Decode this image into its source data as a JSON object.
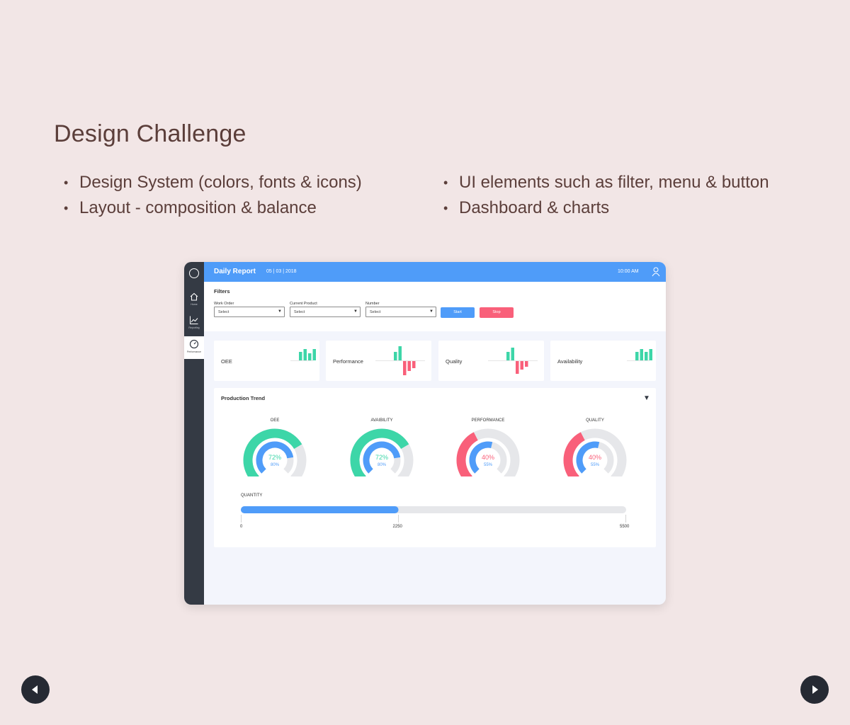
{
  "slide": {
    "title": "Design Challenge",
    "bullets_left": [
      "Design System (colors, fonts & icons)",
      "Layout - composition & balance"
    ],
    "bullets_right": [
      "UI elements such as filter, menu & button",
      "Dashboard & charts"
    ]
  },
  "nav": {
    "prev_icon": "arrow-left-icon",
    "next_icon": "arrow-right-icon"
  },
  "app": {
    "header": {
      "title": "Daily Report",
      "date": "05 | 03 | 2018",
      "time": "10:00 AM",
      "user_icon": "user-icon"
    },
    "sidebar": {
      "items": [
        {
          "label": "Home",
          "icon": "home-icon"
        },
        {
          "label": "Reporting",
          "icon": "chart-line-icon"
        },
        {
          "label": "Performance",
          "icon": "speedometer-icon",
          "active": true
        }
      ]
    },
    "filters": {
      "title": "Filters",
      "fields": [
        {
          "label": "Work Order",
          "value": "Select"
        },
        {
          "label": "Current Product",
          "value": "Select"
        },
        {
          "label": "Number",
          "value": "Select"
        }
      ],
      "start_label": "Start",
      "stop_label": "Stop"
    },
    "kpis": [
      {
        "label": "OEE",
        "bars": [
          3,
          4,
          2.5,
          4
        ],
        "neg_bars": []
      },
      {
        "label": "Performance",
        "bars": [
          3,
          5
        ],
        "neg_bars": [
          5,
          3.5,
          2.5
        ]
      },
      {
        "label": "Quality",
        "bars": [
          3,
          4.5
        ],
        "neg_bars": [
          4.5,
          3,
          2
        ]
      },
      {
        "label": "Availability",
        "bars": [
          3,
          4,
          3,
          4
        ],
        "neg_bars": []
      }
    ],
    "trend": {
      "title": "Production Trend",
      "gauges": [
        {
          "label": "OEE",
          "outer": 0.72,
          "inner": 0.8,
          "main_text": "72%",
          "sub_text": "80%",
          "color": "#3dd6a8"
        },
        {
          "label": "AVAIBILITY",
          "outer": 0.72,
          "inner": 0.8,
          "main_text": "72%",
          "sub_text": "80%",
          "color": "#3dd6a8"
        },
        {
          "label": "PERFORMANCE",
          "outer": 0.4,
          "inner": 0.55,
          "main_text": "40%",
          "sub_text": "55%",
          "color": "#f9607a"
        },
        {
          "label": "QUALITY",
          "outer": 0.4,
          "inner": 0.55,
          "main_text": "40%",
          "sub_text": "55%",
          "color": "#f9607a"
        }
      ],
      "quantity": {
        "label": "QUANTITY",
        "value": 2250,
        "max": 5500,
        "ticks": [
          "0",
          "2250",
          "5500"
        ]
      }
    },
    "colors": {
      "blue": "#4f9cf9",
      "green": "#3dd6a8",
      "red": "#f9607a",
      "sidebar": "#343a44",
      "track": "#e6e7ea"
    }
  }
}
